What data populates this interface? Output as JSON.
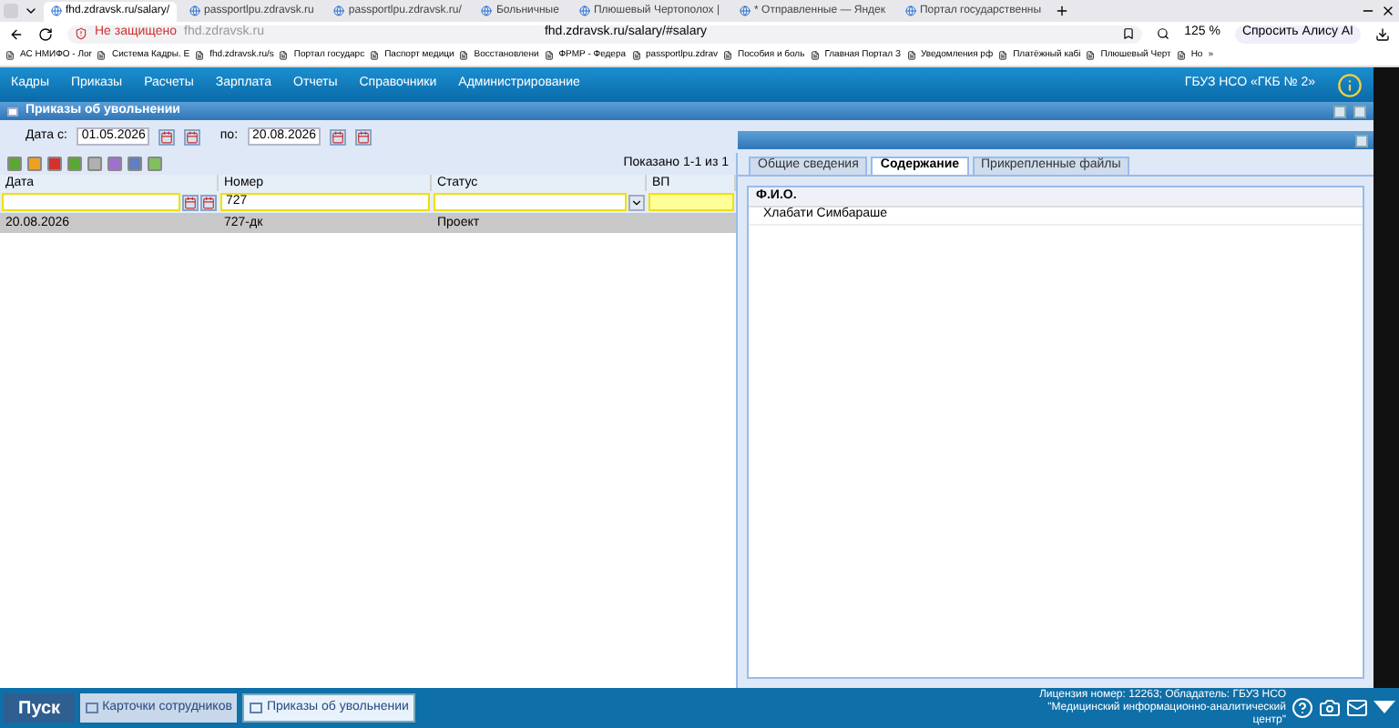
{
  "browser": {
    "tabs": [
      {
        "label": "fhd.zdravsk.ru/salary/",
        "selected": true
      },
      {
        "label": "passportlpu.zdravsk.ru",
        "selected": false
      },
      {
        "label": "passportlpu.zdravsk.ru/",
        "selected": false
      },
      {
        "label": "Больничные",
        "selected": false
      },
      {
        "label": "Плюшевый Чертополох |",
        "selected": false
      },
      {
        "label": "* Отправленные — Яндек",
        "selected": false
      },
      {
        "label": "Портал государственны",
        "selected": false
      }
    ],
    "security": "Не защищено",
    "host": "fhd.zdravsk.ru",
    "url": "fhd.zdravsk.ru/salary/#salary",
    "zoom": "125 %",
    "assistant": "Спросить Алису AI",
    "bookmarks": [
      "АС НМИФО - Лоr",
      "Система Кадры. E",
      "fhd.zdravsk.ru/s",
      "Портал государс",
      "Паспорт медици",
      "Восстановлени",
      "ФРМР - Федера",
      "passportlpu.zdrav",
      "Пособия и боль",
      "Главная Портал З",
      "Уведомления рф",
      "Платёжный кабі",
      "Плюшевый Черт",
      "Но"
    ],
    "more": "»"
  },
  "app": {
    "menu": [
      "Кадры",
      "Приказы",
      "Расчеты",
      "Зарплата",
      "Отчеты",
      "Справочники",
      "Администрирование"
    ],
    "org": "ГБУЗ НСО «ГКБ № 2»"
  },
  "window": {
    "title": "Приказы об увольнении"
  },
  "filter": {
    "from_label": "Дата с:",
    "from": "01.05.2026",
    "to_label": "по:",
    "to": "20.08.2026"
  },
  "pager": "Показано 1-1 из 1",
  "grid": {
    "columns": [
      "Дата",
      "Номер",
      "Статус",
      "ВП"
    ],
    "filters": [
      {
        "kind": "date"
      },
      {
        "kind": "text",
        "value": "727"
      },
      {
        "kind": "select"
      },
      {
        "kind": "text"
      }
    ],
    "rows": [
      {
        "cells": [
          "20.08.2026",
          "727-дк",
          "Проект",
          ""
        ],
        "selected": true
      }
    ]
  },
  "detail": {
    "tabs": [
      {
        "label": "Общие сведения",
        "selected": false
      },
      {
        "label": "Содержание",
        "selected": true
      },
      {
        "label": "Прикрепленные файлы",
        "selected": false
      }
    ],
    "columns": [
      "Ф.И.О."
    ],
    "rows": [
      "Хлабати Симбараше"
    ]
  },
  "taskbar": {
    "start": "Пуск",
    "windows": [
      {
        "label": "Карточки сотрудников",
        "selected": false
      },
      {
        "label": "Приказы об увольнении",
        "selected": true
      }
    ],
    "license": "Лицензия номер: 12263; Обладатель: ГБУЗ НСО \"Медицинский информационно-аналитический центр\""
  }
}
